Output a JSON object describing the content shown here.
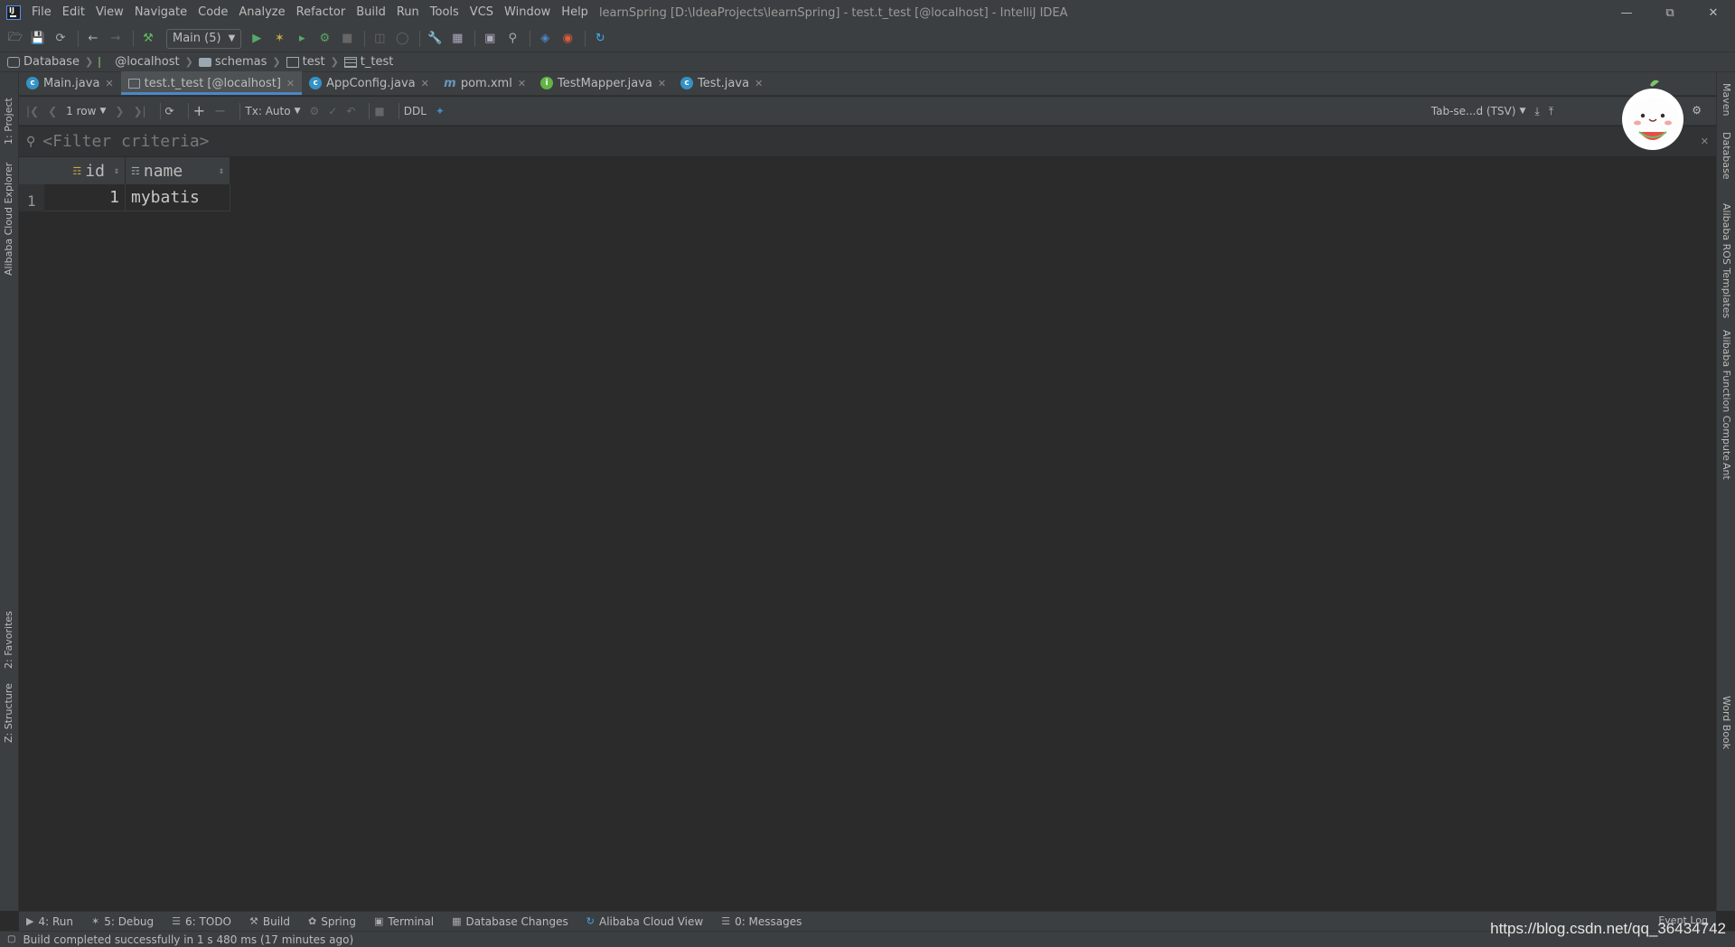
{
  "menu": [
    "File",
    "Edit",
    "View",
    "Navigate",
    "Code",
    "Analyze",
    "Refactor",
    "Build",
    "Run",
    "Tools",
    "VCS",
    "Window",
    "Help"
  ],
  "window_title": "learnSpring [D:\\IdeaProjects\\learnSpring] - test.t_test [@localhost] - IntelliJ IDEA",
  "run_config": "Main (5)",
  "breadcrumbs": [
    "Database",
    "@localhost",
    "schemas",
    "test",
    "t_test"
  ],
  "editor_tabs": [
    {
      "label": "Main.java",
      "icon": "class-icon",
      "color": "#3592c4"
    },
    {
      "label": "test.t_test [@localhost]",
      "icon": "table-icon",
      "color": "#9aa7b0",
      "active": true
    },
    {
      "label": "AppConfig.java",
      "icon": "class-icon",
      "color": "#3592c4"
    },
    {
      "label": "pom.xml",
      "icon": "maven-icon",
      "color": "#6897bb"
    },
    {
      "label": "TestMapper.java",
      "icon": "interface-icon",
      "color": "#62b543"
    },
    {
      "label": "Test.java",
      "icon": "class-icon",
      "color": "#3592c4"
    }
  ],
  "grid_toolbar": {
    "rows": "1 row",
    "tx": "Tx: Auto",
    "ddl": "DDL",
    "export_format": "Tab-se...d (TSV)"
  },
  "filter": {
    "placeholder": "<Filter criteria>"
  },
  "table": {
    "columns": [
      "id",
      "name"
    ],
    "rows": [
      {
        "num": "1",
        "id": "1",
        "name": "mybatis"
      }
    ]
  },
  "left_tool_tabs": [
    "1: Project",
    "Alibaba Cloud Explorer",
    "2: Favorites",
    "Z: Structure"
  ],
  "right_tool_tabs": [
    "Maven",
    "Database",
    "Alibaba ROS Templates",
    "Alibaba Function Compute",
    "Ant",
    "Word Book"
  ],
  "bottom_tabs": [
    "4: Run",
    "5: Debug",
    "6: TODO",
    "Build",
    "Spring",
    "Terminal",
    "Database Changes",
    "Alibaba Cloud View",
    "0: Messages"
  ],
  "event_log": "Event Log",
  "status": "Build completed successfully in 1 s 480 ms (17 minutes ago)",
  "watermark": "https://blog.csdn.net/qq_36434742"
}
